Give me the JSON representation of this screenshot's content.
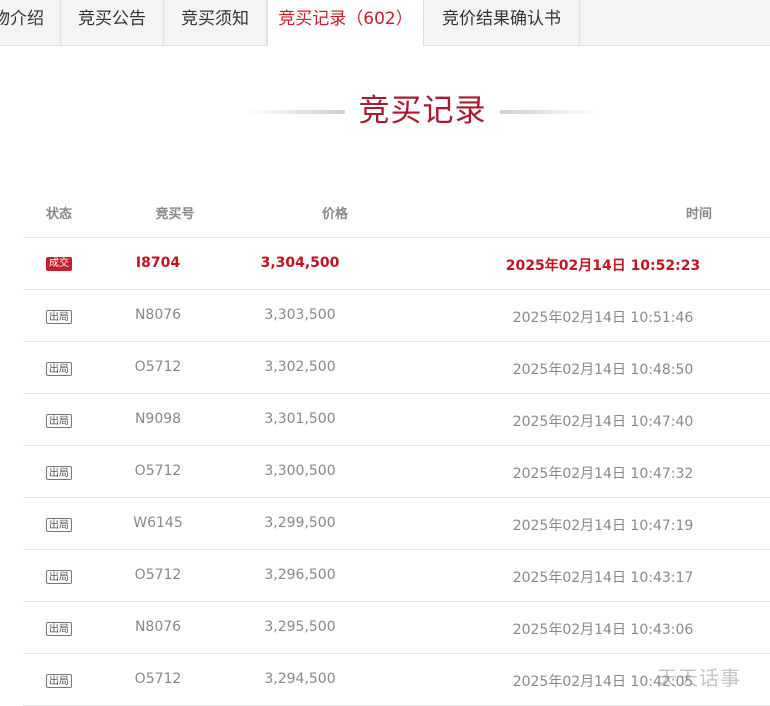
{
  "tabs": [
    {
      "label": "物介绍"
    },
    {
      "label": "竞买公告"
    },
    {
      "label": "竞买须知"
    },
    {
      "label": "竞买记录（602）"
    },
    {
      "label": "竞价结果确认书"
    }
  ],
  "section_title": "竞买记录",
  "table": {
    "headers": {
      "status": "状态",
      "bid_no": "竞买号",
      "price": "价格",
      "time": "时间"
    },
    "rows": [
      {
        "status": "成交",
        "bid_no": "I8704",
        "price": "3,304,500",
        "time": "2025年02月14日 10:52:23"
      },
      {
        "status": "出局",
        "bid_no": "N8076",
        "price": "3,303,500",
        "time": "2025年02月14日 10:51:46"
      },
      {
        "status": "出局",
        "bid_no": "O5712",
        "price": "3,302,500",
        "time": "2025年02月14日 10:48:50"
      },
      {
        "status": "出局",
        "bid_no": "N9098",
        "price": "3,301,500",
        "time": "2025年02月14日 10:47:40"
      },
      {
        "status": "出局",
        "bid_no": "O5712",
        "price": "3,300,500",
        "time": "2025年02月14日 10:47:32"
      },
      {
        "status": "出局",
        "bid_no": "W6145",
        "price": "3,299,500",
        "time": "2025年02月14日 10:47:19"
      },
      {
        "status": "出局",
        "bid_no": "O5712",
        "price": "3,296,500",
        "time": "2025年02月14日 10:43:17"
      },
      {
        "status": "出局",
        "bid_no": "N8076",
        "price": "3,295,500",
        "time": "2025年02月14日 10:43:06"
      },
      {
        "status": "出局",
        "bid_no": "O5712",
        "price": "3,294,500",
        "time": "2025年02月14日 10:42:05"
      }
    ]
  },
  "watermark": "天天话事",
  "colors": {
    "accent": "#c81d2d",
    "title": "#a61b30",
    "text_muted": "#888888"
  }
}
